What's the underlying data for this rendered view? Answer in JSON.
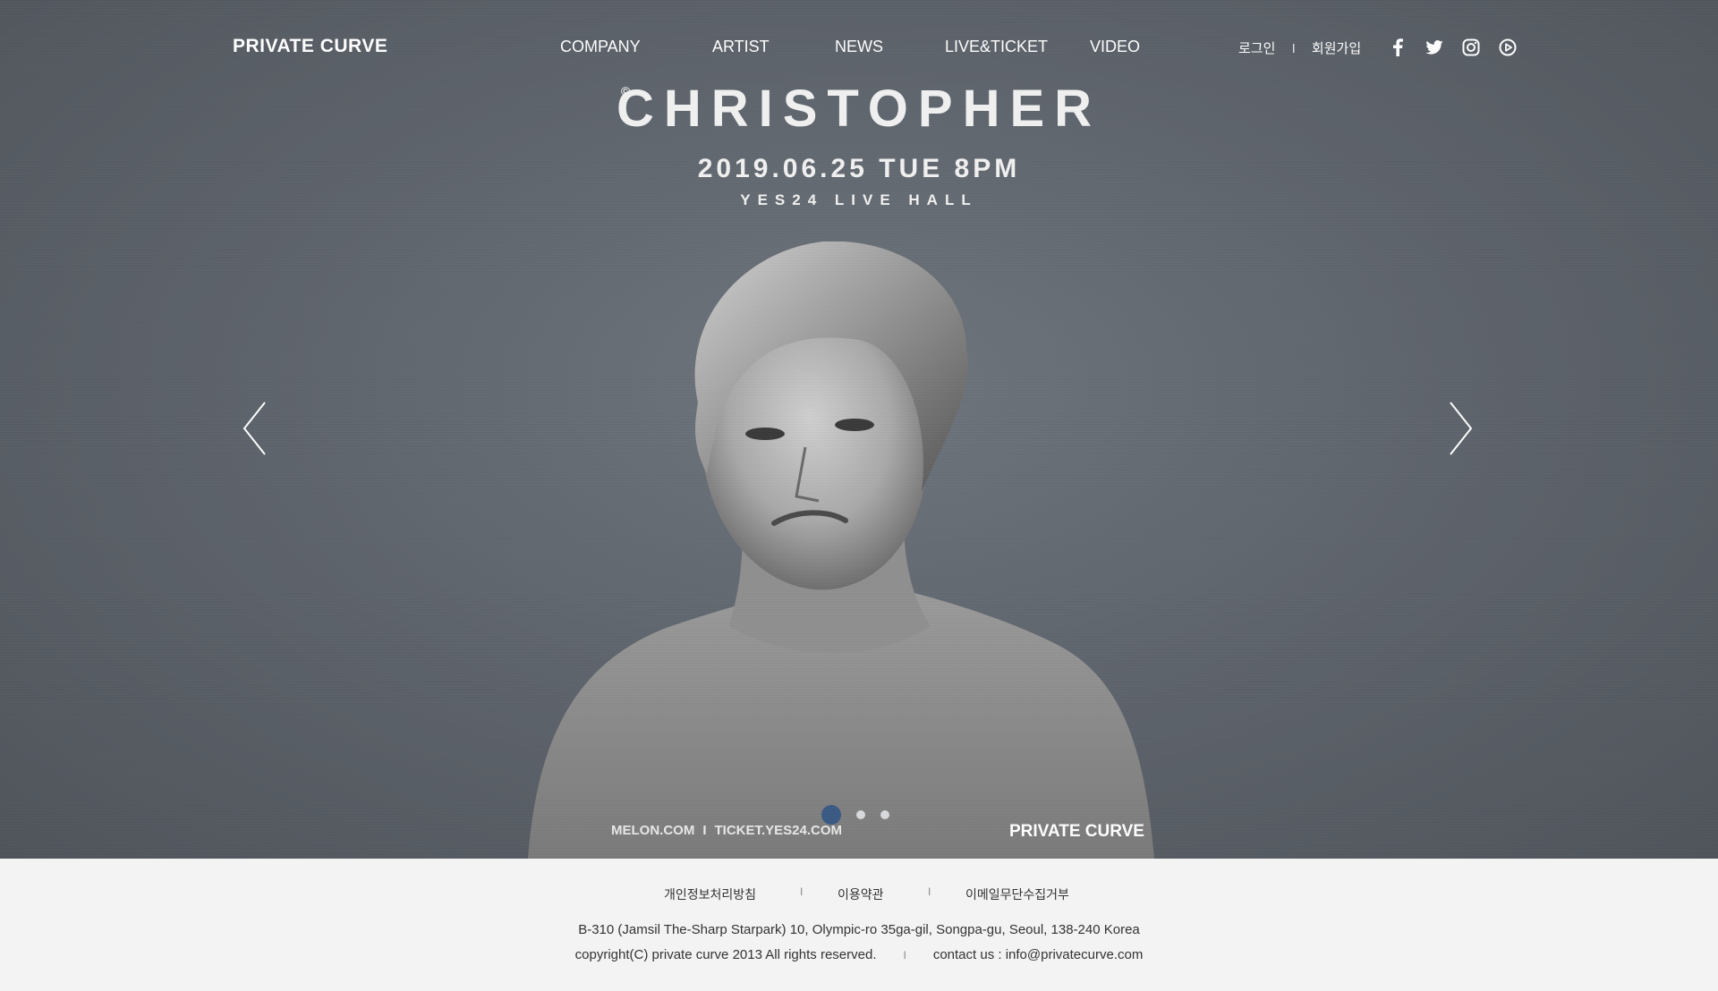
{
  "header": {
    "logo": "PRIVATE CURVE",
    "nav": [
      "COMPANY",
      "ARTIST",
      "NEWS",
      "LIVE&TICKET",
      "VIDEO"
    ],
    "auth": {
      "login": "로그인",
      "separator": "I",
      "signup": "회원가입"
    },
    "social_icons": [
      "facebook-icon",
      "twitter-icon",
      "instagram-icon",
      "youtube-play-icon"
    ]
  },
  "hero": {
    "copyright_mark": "©",
    "title": "CHRISTOPHER",
    "date": "2019.06.25 TUE 8PM",
    "venue": "YES24 LIVE HALL",
    "ticket_sites": {
      "site1": "MELON.COM",
      "separator": "I",
      "site2": "TICKET.YES24.COM"
    },
    "brand_mark": "PRIVATE CURVE",
    "slider": {
      "total": 3,
      "active": 1
    }
  },
  "footer": {
    "links": [
      "개인정보처리방침",
      "이용약관",
      "이메일무단수집거부"
    ],
    "link_separator": "I",
    "address": "B-310 (Jamsil The-Sharp Starpark) 10, Olympic-ro 35ga-gil, Songpa-gu, Seoul, 138-240 Korea",
    "copyright": "copyright(C) private curve 2013 All rights reserved.",
    "contact": "contact us : info@privatecurve.com"
  },
  "colors": {
    "hero_bg": "#60666e",
    "active_dot": "#3a5a84",
    "footer_bg": "#f3f3f3"
  }
}
